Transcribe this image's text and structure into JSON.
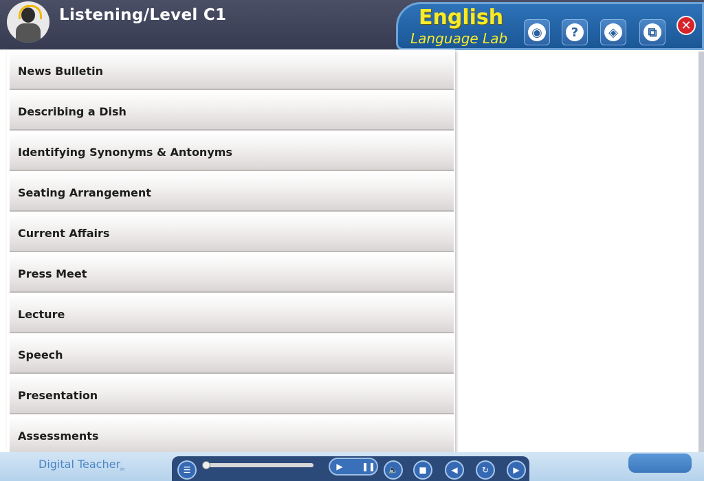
{
  "header": {
    "title": "Listening/Level C1",
    "brand_line1": "English",
    "brand_line2": "Language Lab",
    "buttons": [
      {
        "name": "camera-button",
        "icon": "camera-icon",
        "glyph": "◉"
      },
      {
        "name": "help-button",
        "icon": "question-mark-icon",
        "glyph": "?"
      },
      {
        "name": "eraser-button",
        "icon": "eraser-icon",
        "glyph": "◈"
      },
      {
        "name": "window-button",
        "icon": "window-icon",
        "glyph": "⧉"
      }
    ],
    "close_glyph": "✕"
  },
  "menu": {
    "items": [
      {
        "label": "News Bulletin"
      },
      {
        "label": "Describing a Dish"
      },
      {
        "label": "Identifying Synonyms & Antonyms"
      },
      {
        "label": "Seating Arrangement"
      },
      {
        "label": "Current Affairs"
      },
      {
        "label": "Press Meet"
      },
      {
        "label": "Lecture"
      },
      {
        "label": "Speech"
      },
      {
        "label": "Presentation"
      },
      {
        "label": "Assessments"
      }
    ]
  },
  "footer": {
    "logo_text": "Digital Teacher",
    "logo_suffix": "in",
    "controls": [
      {
        "name": "menu-tree-button",
        "icon": "tree-icon",
        "glyph": "☰"
      },
      {
        "name": "play-button",
        "icon": "play-icon",
        "glyph": "▶"
      },
      {
        "name": "pause-button",
        "icon": "pause-icon",
        "glyph": "❚❚"
      },
      {
        "name": "volume-button",
        "icon": "speaker-icon",
        "glyph": "🔈"
      },
      {
        "name": "stop-button",
        "icon": "stop-icon",
        "glyph": "■"
      },
      {
        "name": "back-button",
        "icon": "left-arrow-icon",
        "glyph": "◀"
      },
      {
        "name": "replay-button",
        "icon": "replay-icon",
        "glyph": "↻"
      },
      {
        "name": "next-button",
        "icon": "right-arrow-icon",
        "glyph": "▶"
      }
    ]
  },
  "colors": {
    "header_bg": "#3f4359",
    "brand_panel": "#1f5ea0",
    "brand_text": "#f7ea2b",
    "close_red": "#d8232a",
    "footer_bg": "#c5dcf1"
  }
}
